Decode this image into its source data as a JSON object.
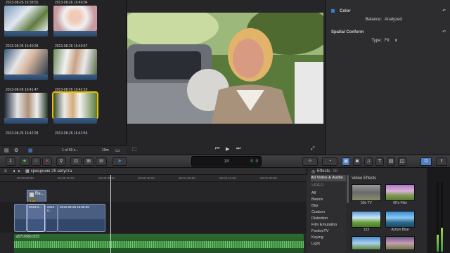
{
  "browser": {
    "clips": [
      {
        "date": "2013-08-26 16:38:55"
      },
      {
        "date": "2013-08-26 16:40:04"
      },
      {
        "date": "2013-08-26 16:40:28"
      },
      {
        "date": "2013-08-26 16:40:57"
      },
      {
        "date": "2013-08-26 16:41:47"
      },
      {
        "date": "2013-08-26 16:42:10"
      },
      {
        "date": "2013-08-26 16:42:28"
      },
      {
        "date": "2013-08-26 16:42:55"
      }
    ],
    "selection_info": "1 of 59 s...",
    "duration": "10m"
  },
  "inspector": {
    "color_title": "Color",
    "balance_label": "Balance:",
    "balance_value": "Analyzed",
    "spatial_title": "Spatial Conform",
    "type_label": "Type:",
    "type_value": "Fit"
  },
  "toolbar": {
    "timecode": "18",
    "audio_level": "0.0"
  },
  "timeline": {
    "project_title": "крещение 25 августа",
    "ruler_ticks": [
      "00:00:00:00",
      "00:00:15:00",
      "00:00:30:00",
      "00:00:45:00",
      "00:01:00:00",
      "00:01:15:00",
      "00:01:30:00"
    ],
    "connected_clip": "Re...",
    "connected_sub": "4:14",
    "primary_clip_1": "2013-0...",
    "primary_clip_2": "2013-0...",
    "primary_clip_3": "2013-08-26 16:56:59",
    "audio_clip": "a571699cc033"
  },
  "effects": {
    "title": "Effects",
    "filter": "All",
    "category_header": "All Video & Audio",
    "section_video": "VIDEO",
    "categories": [
      "All",
      "Basics",
      "Blur",
      "Custom",
      "Distortion",
      "Film Emulation",
      "FordeeTV",
      "Keying",
      "Light"
    ],
    "grid_header": "Video Effects",
    "items": [
      {
        "name": "50s TV"
      },
      {
        "name": "90's Film"
      },
      {
        "name": "123"
      },
      {
        "name": "Action Blue"
      }
    ]
  }
}
